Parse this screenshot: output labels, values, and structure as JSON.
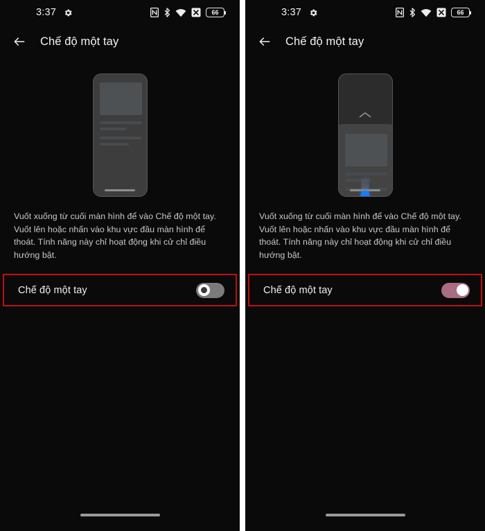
{
  "meta": {
    "panel_count": 2
  },
  "status_bar": {
    "clock": "3:37",
    "gear_icon": "gear-icon",
    "icons": [
      "nfc-icon",
      "bluetooth-icon",
      "wifi-icon",
      "no-signal-icon"
    ],
    "battery_level": "66"
  },
  "app_bar": {
    "back_icon": "back-arrow-icon",
    "title": "Chế độ một tay"
  },
  "description": "Vuốt xuống từ cuối màn hình để vào Chế độ một tay. Vuốt lên hoặc nhấn vào khu vực đầu màn hình để thoát. Tính năng này chỉ hoạt động khi cử chỉ điều hướng bật.",
  "setting_row": {
    "label": "Chế độ một tay"
  },
  "panels": [
    {
      "id": "left",
      "illustration": "phone-normal-mode",
      "toggle_state": "off",
      "toggle_aria": "Tắt"
    },
    {
      "id": "right",
      "illustration": "phone-one-handed-mode",
      "toggle_state": "on",
      "toggle_aria": "Bật"
    }
  ],
  "colors": {
    "highlight_border": "#c10e0e",
    "toggle_on_track": "#a96c80",
    "toggle_off_track": "#7b7b7b",
    "accent_blue_dot": "#1a7cf0",
    "background": "#0a0a0a"
  }
}
